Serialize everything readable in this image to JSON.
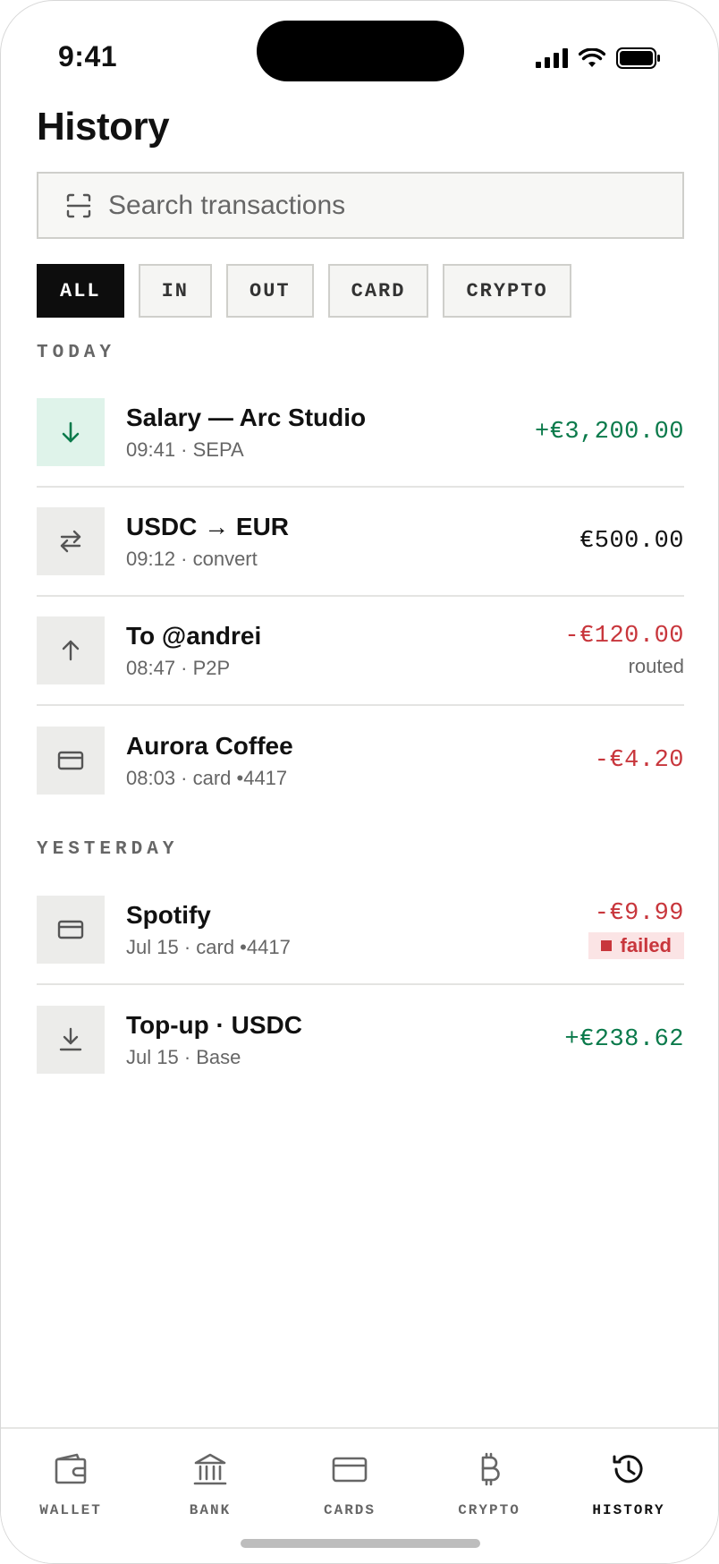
{
  "status_bar": {
    "time": "9:41"
  },
  "page": {
    "title": "History"
  },
  "search": {
    "placeholder": "Search transactions"
  },
  "filters": [
    {
      "label": "ALL",
      "active": true
    },
    {
      "label": "IN",
      "active": false
    },
    {
      "label": "OUT",
      "active": false
    },
    {
      "label": "CARD",
      "active": false
    },
    {
      "label": "CRYPTO",
      "active": false
    }
  ],
  "sections": {
    "today": "TODAY",
    "yesterday": "YESTERDAY"
  },
  "transactions": [
    {
      "icon": "arrow-down-icon",
      "name": "Salary — Arc Studio",
      "sub": "09:41 · SEPA",
      "amount": "+€3,200.00",
      "kind": "positive"
    },
    {
      "icon": "swap-icon",
      "name": "USDC → EUR",
      "sub": "09:12 · convert",
      "amount": "€500.00",
      "kind": "neutral"
    },
    {
      "icon": "arrow-up-icon",
      "name": "To @andrei",
      "sub": "08:47 · P2P",
      "amount": "-€120.00",
      "kind": "negative",
      "note": "routed"
    },
    {
      "icon": "card-icon",
      "name": "Aurora Coffee",
      "sub": "08:03 · card •4417",
      "amount": "-€4.20",
      "kind": "negative"
    },
    {
      "icon": "card-icon",
      "name": "Spotify",
      "sub": "Jul 15 · card •4417",
      "amount": "-€9.99",
      "kind": "negative",
      "status": "failed"
    },
    {
      "icon": "download-icon",
      "name": "Top-up · USDC",
      "sub": "Jul 15 · Base",
      "amount": "+€238.62",
      "kind": "positive"
    }
  ],
  "nav": [
    {
      "label": "WALLET",
      "icon": "wallet-icon",
      "active": false
    },
    {
      "label": "BANK",
      "icon": "bank-icon",
      "active": false
    },
    {
      "label": "CARDS",
      "icon": "card-icon",
      "active": false
    },
    {
      "label": "CRYPTO",
      "icon": "bitcoin-icon",
      "active": false
    },
    {
      "label": "HISTORY",
      "icon": "history-icon",
      "active": true
    }
  ],
  "colors": {
    "positive": "#0b7a4b",
    "negative": "#c8363c",
    "active_chip": "#0d0d0d",
    "icon_bg_in": "#dff3ea",
    "icon_bg": "#ececea"
  }
}
